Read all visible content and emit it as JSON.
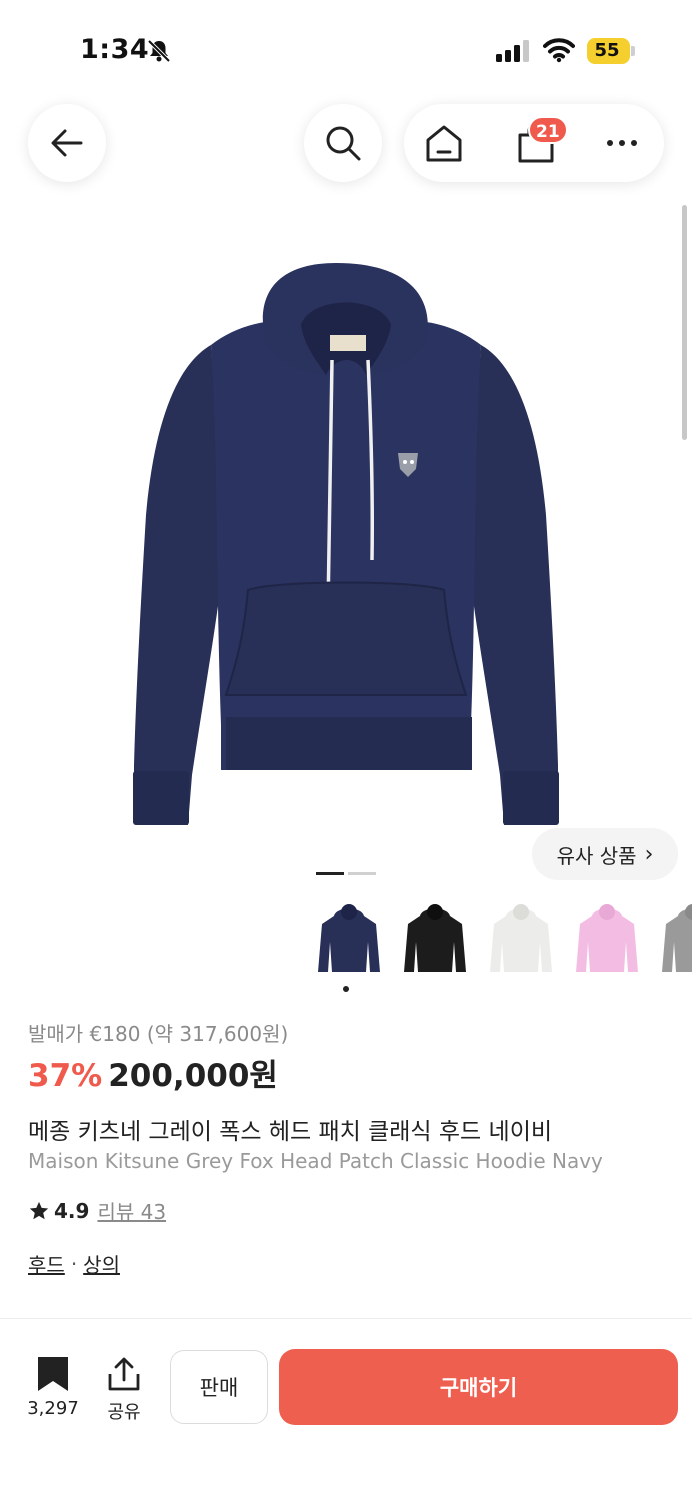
{
  "status_bar": {
    "time": "1:34",
    "battery": "55"
  },
  "nav": {
    "cart_count": "21"
  },
  "product": {
    "similar_label": "유사 상품",
    "original_price": "발매가 €180 (약 317,600원)",
    "discount": "37%",
    "price": "200,000원",
    "title_ko": "메종 키츠네 그레이 폭스 헤드 패치 클래식 후드 네이비",
    "title_en": "Maison Kitsune Grey Fox Head Patch Classic Hoodie Navy",
    "rating": "4.9",
    "reviews": "리뷰 43",
    "categories": [
      "후드",
      "상의"
    ],
    "category_sep": "·",
    "thumbnails": [
      {
        "name": "navy",
        "color": "#283057"
      },
      {
        "name": "black",
        "color": "#1c1c1c"
      },
      {
        "name": "white",
        "color": "#ececea"
      },
      {
        "name": "pink",
        "color": "#f3bde3"
      },
      {
        "name": "grey",
        "color": "#9a9a9a"
      }
    ]
  },
  "bottom_bar": {
    "bookmark_count": "3,297",
    "share_label": "공유",
    "sell_label": "판매",
    "buy_label": "구매하기"
  },
  "colors": {
    "accent": "#ef5a4d",
    "navy": "#283057"
  }
}
